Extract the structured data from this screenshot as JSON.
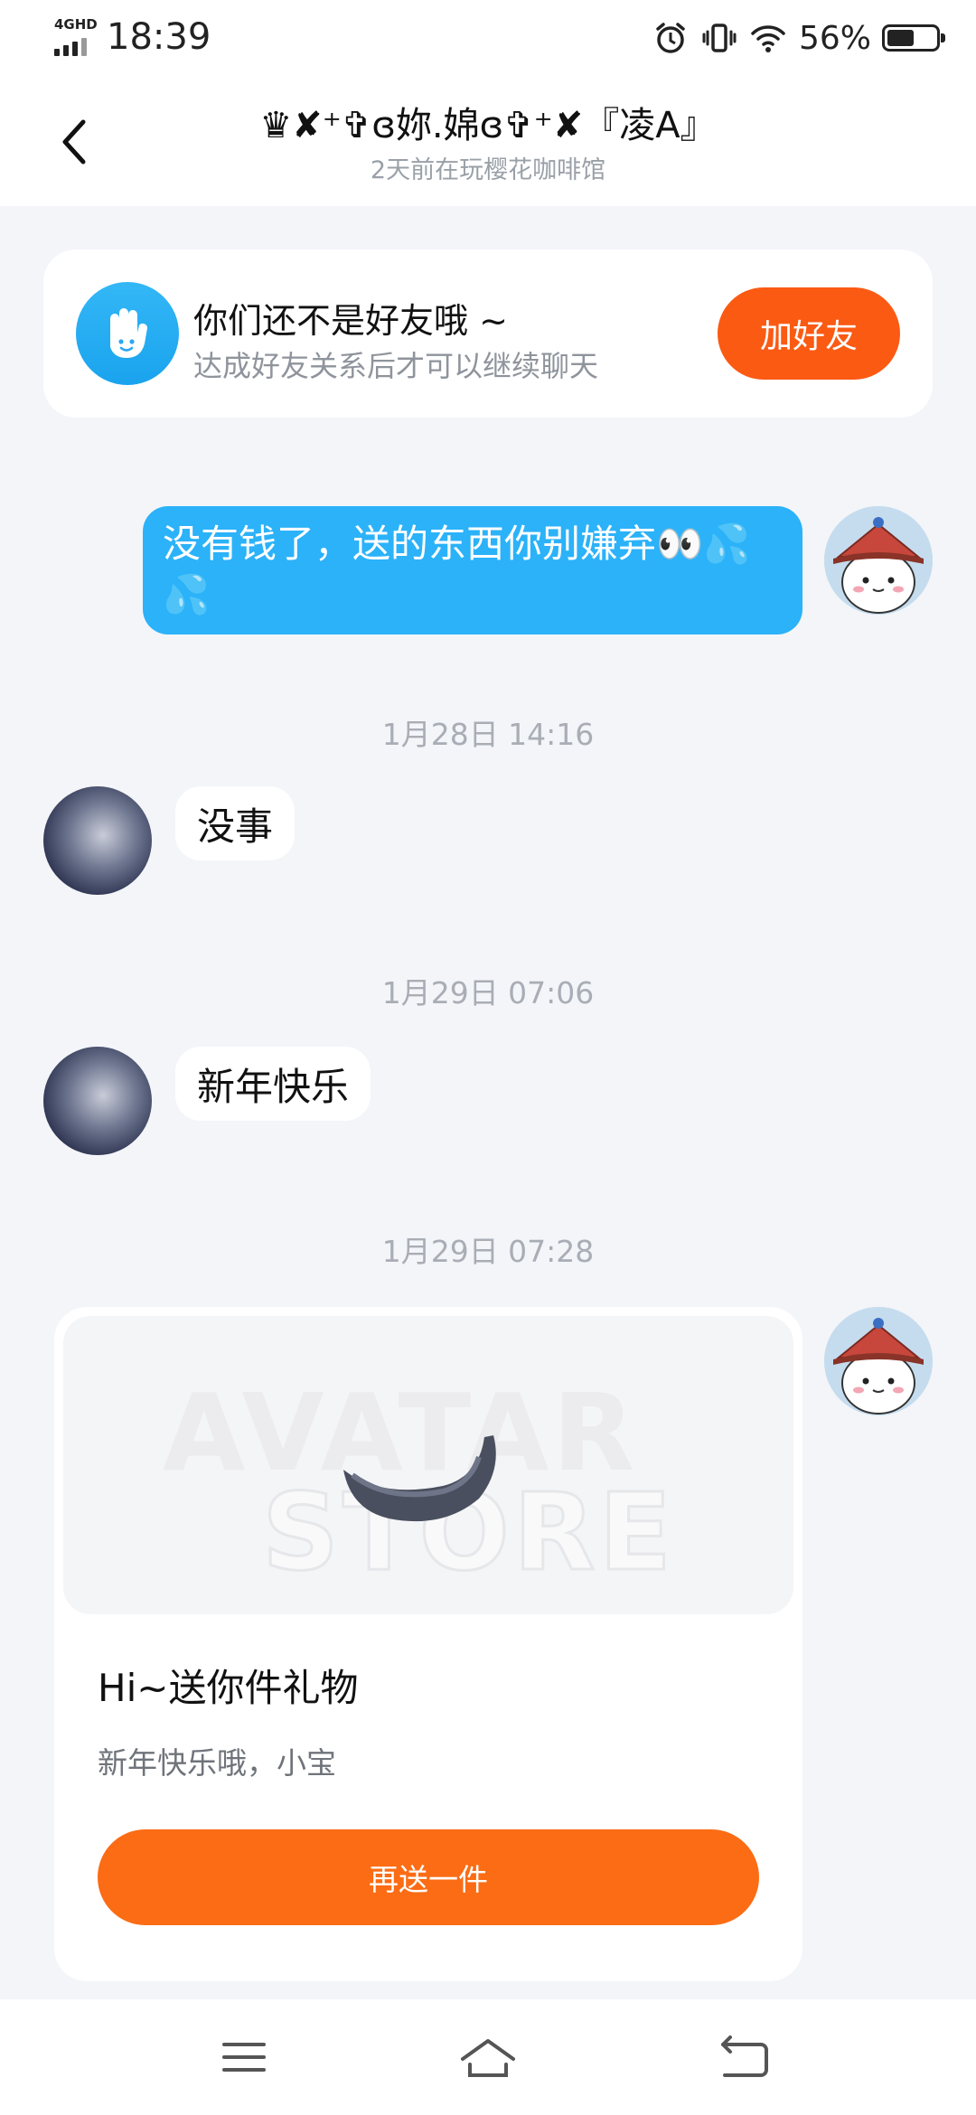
{
  "status_bar": {
    "network_label": "4GHD",
    "time": "18:39",
    "battery_percent": "56%",
    "battery_level": 0.56
  },
  "header": {
    "title": "♛✘⁺✞ɞ妳.婂ɞ✞⁺✘『凌A』",
    "subtitle": "2天前在玩樱花咖啡馆"
  },
  "friend_banner": {
    "title": "你们还不是好友哦 ~",
    "description": "达成好友关系后才可以继续聊天",
    "button_label": "加好友"
  },
  "messages": [
    {
      "side": "me",
      "text": "没有钱了，送的东西你别嫌弃👀💦💦"
    },
    {
      "timestamp": "1月28日 14:16"
    },
    {
      "side": "them",
      "text": "没事"
    },
    {
      "timestamp": "1月29日 07:06"
    },
    {
      "side": "them",
      "text": "新年快乐"
    },
    {
      "timestamp": "1月29日 07:28"
    }
  ],
  "gift_card": {
    "watermark_line1": "AVATAR",
    "watermark_line2": "STORE",
    "title": "Hi~送你件礼物",
    "subtitle": "新年快乐哦，小宝",
    "button_label": "再送一件"
  },
  "colors": {
    "accent_orange": "#fb5a13",
    "bubble_blue": "#2bb2f9",
    "background": "#f3f5f9"
  },
  "icons": {
    "back": "chevron-left-icon",
    "banner": "waving-hand-icon",
    "nav_menu": "menu-icon",
    "nav_home": "home-icon",
    "nav_back": "return-icon"
  }
}
